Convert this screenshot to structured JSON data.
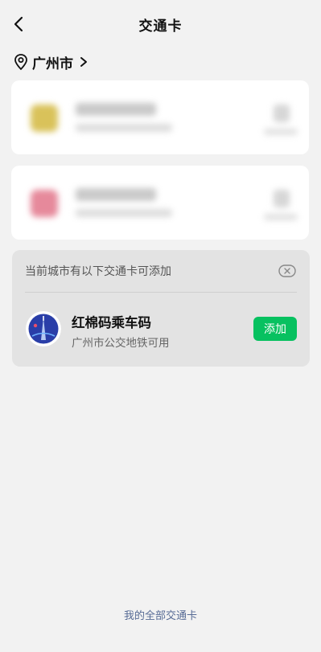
{
  "header": {
    "title": "交通卡"
  },
  "city": {
    "name": "广州市"
  },
  "available": {
    "heading": "当前城市有以下交通卡可添加",
    "card": {
      "name": "红棉码乘车码",
      "desc": "广州市公交地铁可用",
      "add_label": "添加"
    }
  },
  "footer": {
    "link": "我的全部交通卡"
  },
  "colors": {
    "accent": "#07c160",
    "link": "#576b95",
    "background": "#f2f2f2"
  }
}
